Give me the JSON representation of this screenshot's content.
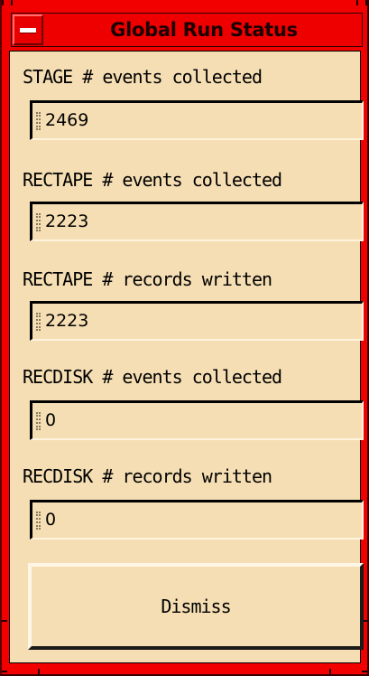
{
  "window": {
    "title": "Global Run Status",
    "frame_color": "#f20000",
    "panel_color": "#f5deb3"
  },
  "fields": [
    {
      "label": "STAGE # events collected",
      "value": "2469"
    },
    {
      "label": "RECTAPE # events collected",
      "value": "2223"
    },
    {
      "label": "RECTAPE # records written",
      "value": "2223"
    },
    {
      "label": "RECDISK # events collected",
      "value": "0"
    },
    {
      "label": "RECDISK # records written",
      "value": "0"
    }
  ],
  "buttons": {
    "dismiss_label": "Dismiss"
  },
  "icons": {
    "window_menu": "window-menu-icon"
  }
}
